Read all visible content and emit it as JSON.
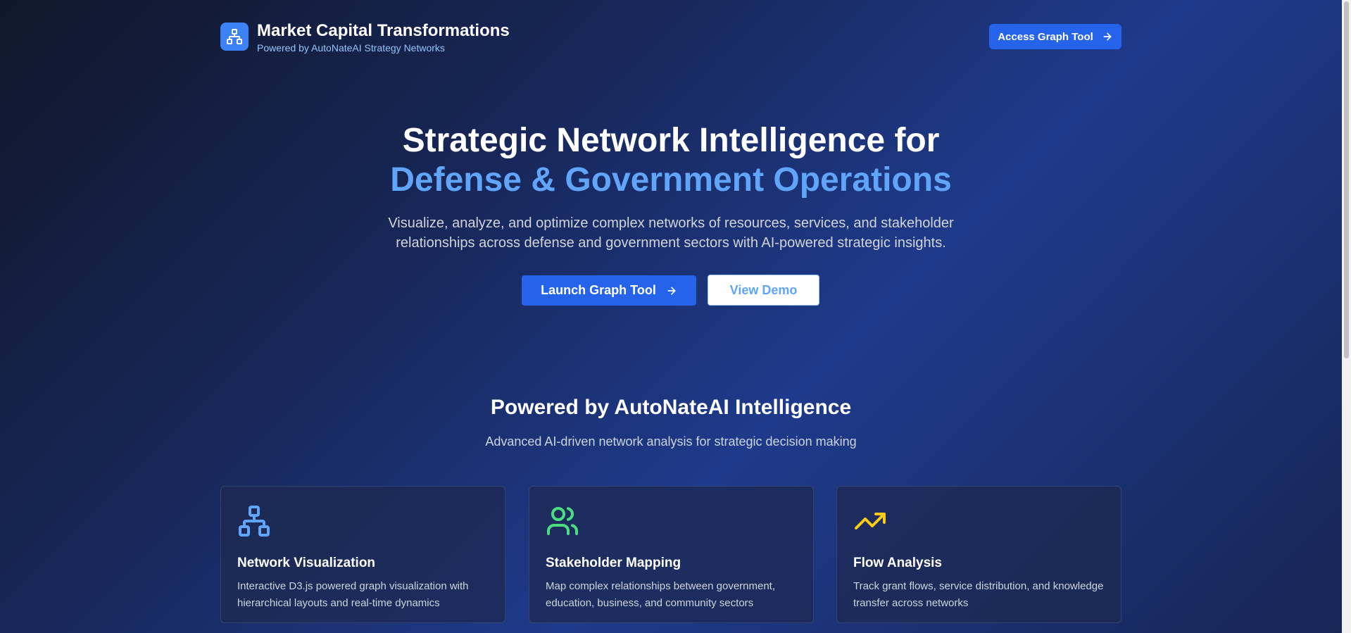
{
  "header": {
    "logo_icon": "network-icon",
    "title": "Market Capital Transformations",
    "subtitle": "Powered by AutoNateAI Strategy Networks",
    "access_button": "Access Graph Tool"
  },
  "hero": {
    "title_line1": "Strategic Network Intelligence for",
    "title_line2": "Defense & Government Operations",
    "desc_line1": "Visualize, analyze, and optimize complex networks of resources, services, and stakeholder",
    "desc_line2": "relationships across defense and government sectors with AI-powered strategic insights.",
    "launch_button": "Launch Graph Tool",
    "demo_button": "View Demo"
  },
  "features": {
    "title": "Powered by AutoNateAI Intelligence",
    "subtitle": "Advanced AI-driven network analysis for strategic decision making",
    "cards": [
      {
        "icon": "network-icon",
        "title": "Network Visualization",
        "description": "Interactive D3.js powered graph visualization with hierarchical layouts and real-time dynamics"
      },
      {
        "icon": "users-icon",
        "title": "Stakeholder Mapping",
        "description": "Map complex relationships between government, education, business, and community sectors"
      },
      {
        "icon": "trending-up-icon",
        "title": "Flow Analysis",
        "description": "Track grant flows, service distribution, and knowledge transfer across networks"
      }
    ]
  },
  "colors": {
    "accent": "#2563eb",
    "highlight": "#60a5fa",
    "network_icon": "#60a5fa",
    "users_icon": "#4ade80",
    "trend_icon": "#facc15"
  }
}
